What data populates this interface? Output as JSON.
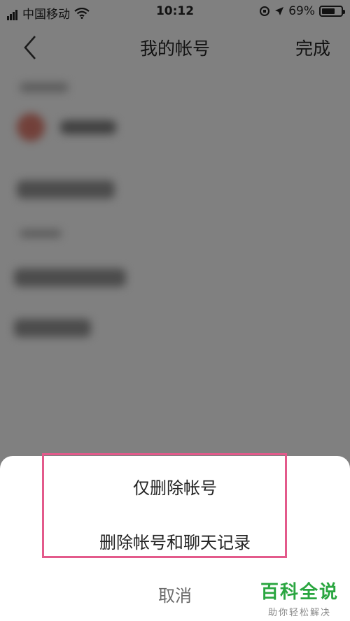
{
  "status_bar": {
    "carrier": "中国移动",
    "time": "10:12",
    "battery": "69%",
    "battery_level": 0.69,
    "icons": [
      "signal-icon",
      "wifi-icon",
      "lock-rotation-icon",
      "location-icon",
      "battery-icon"
    ]
  },
  "nav": {
    "back_icon": "chevron-left-icon",
    "title": "我的帐号",
    "done_label": "完成"
  },
  "action_sheet": {
    "delete_account_only": "仅删除帐号",
    "delete_account_and_chats": "删除帐号和聊天记录",
    "cancel": "取消"
  },
  "watermark": {
    "brand": "百科全说",
    "slogan": "助你轻松解决"
  },
  "colors": {
    "highlight": "#e35a8b",
    "watermark": "#2aa640"
  }
}
